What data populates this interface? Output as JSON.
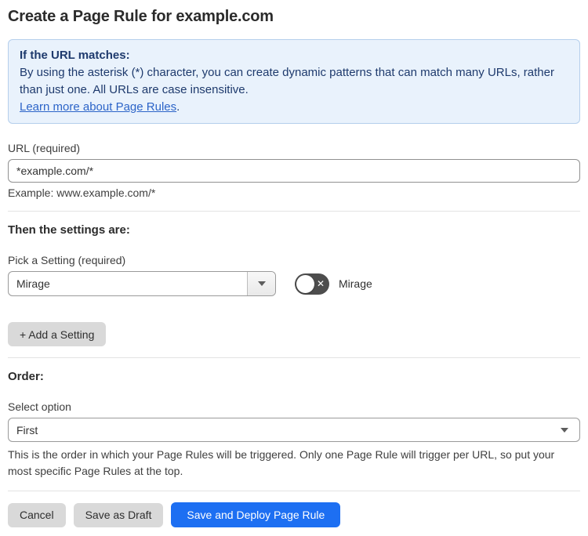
{
  "page": {
    "title": "Create a Page Rule for example.com"
  },
  "callout": {
    "heading": "If the URL matches:",
    "body": "By using the asterisk (*) character, you can create dynamic patterns that can match many URLs, rather than just one. All URLs are case insensitive.",
    "link_label": "Learn more about Page Rules",
    "link_suffix": "."
  },
  "url_field": {
    "label": "URL (required)",
    "value": "*example.com/*",
    "helper": "Example: www.example.com/*"
  },
  "settings_section": {
    "heading": "Then the settings are:",
    "picker_label": "Pick a Setting (required)",
    "selected_setting": "Mirage",
    "toggle": {
      "state": "off",
      "glyph": "✕",
      "label": "Mirage"
    },
    "add_setting_label": "+ Add a Setting"
  },
  "order_section": {
    "heading": "Order:",
    "select_label": "Select option",
    "selected_option": "First",
    "helper": "This is the order in which your Page Rules will be triggered. Only one Page Rule will trigger per URL, so put your most specific Page Rules at the top."
  },
  "actions": {
    "cancel_label": "Cancel",
    "save_draft_label": "Save as Draft",
    "save_deploy_label": "Save and Deploy Page Rule"
  },
  "colors": {
    "primary_button_blue": "#1d6ff2",
    "callout_background": "#e9f2fc",
    "callout_border": "#b5cfec",
    "callout_text": "#1e3a6d",
    "link_blue": "#2c64c8",
    "toggle_off_gray": "#4d4d4d",
    "secondary_button_gray": "#d9d9d9"
  }
}
